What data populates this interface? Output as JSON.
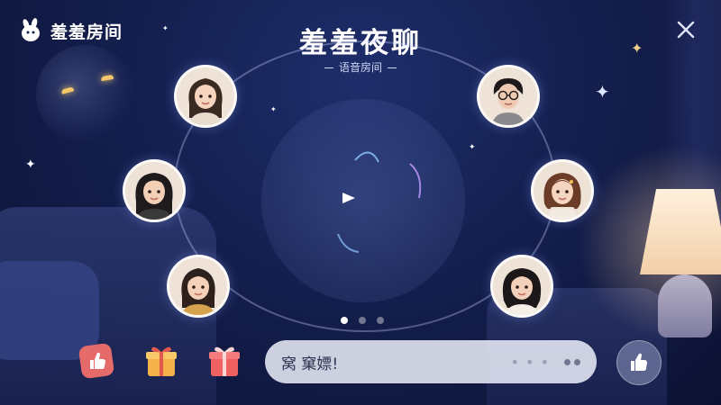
{
  "header": {
    "brand_name": "羞羞房间",
    "title": "羞羞夜聊",
    "subtitle": "语音房间"
  },
  "icons": {
    "brand": "bunny-logo-icon",
    "close": "close-icon",
    "thumbs_up": "thumbs-up-icon",
    "gift": "gift-icon",
    "play": "play-icon"
  },
  "participants": [
    {
      "id": "p1",
      "desc": "girl long dark hair"
    },
    {
      "id": "p2",
      "desc": "boy with glasses"
    },
    {
      "id": "p3",
      "desc": "girl dark hair"
    },
    {
      "id": "p4",
      "desc": "girl curly hair"
    },
    {
      "id": "p5",
      "desc": "girl long hair"
    },
    {
      "id": "p6",
      "desc": "girl wavy hair"
    }
  ],
  "pager": {
    "count": 3,
    "active": 0
  },
  "composer": {
    "text": "窝 窠嫖!",
    "more": "• • •"
  },
  "colors": {
    "background": "#141f4e",
    "wave_start": "#5fb8ff",
    "wave_end": "#b06cff",
    "gift_yellow": "#f3b34a",
    "gift_red": "#ef6161",
    "thumb_red": "#e56a6a"
  }
}
